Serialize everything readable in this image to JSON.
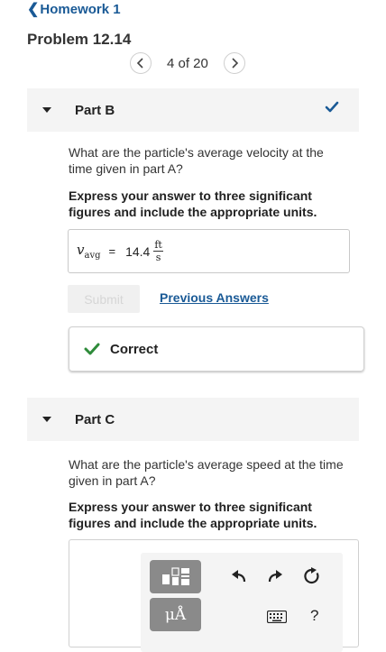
{
  "nav": {
    "back_label": "Homework 1"
  },
  "problem": {
    "title": "Problem 12.14"
  },
  "pager": {
    "text": "4 of 20"
  },
  "part_b": {
    "title": "Part B",
    "question": "What are the particle's average velocity at the time given in part A?",
    "instruction": "Express your answer to three significant figures and include the appropriate units.",
    "answer": {
      "variable": "v",
      "subscript": "avg",
      "equals": "=",
      "value": "14.4",
      "unit_num": "ft",
      "unit_den": "s"
    },
    "submit_label": "Submit",
    "previous_answers_label": "Previous Answers",
    "result_label": "Correct"
  },
  "part_c": {
    "title": "Part C",
    "question": "What are the particle's average speed at the time given in part A?",
    "instruction": "Express your answer to three significant figures and include the appropriate units.",
    "toolbar": {
      "units_label": "μÅ",
      "help_label": "?"
    }
  },
  "icons": [
    "chevron-left-icon",
    "chevron-right-icon",
    "caret-down-icon",
    "checkmark-icon",
    "templates-icon",
    "undo-icon",
    "redo-icon",
    "reset-icon",
    "keyboard-icon"
  ],
  "colors": {
    "link": "#1a5a96",
    "check": "#1a5a96",
    "correct_check": "#2e8b3a",
    "header_bg": "#f4f4f4"
  }
}
